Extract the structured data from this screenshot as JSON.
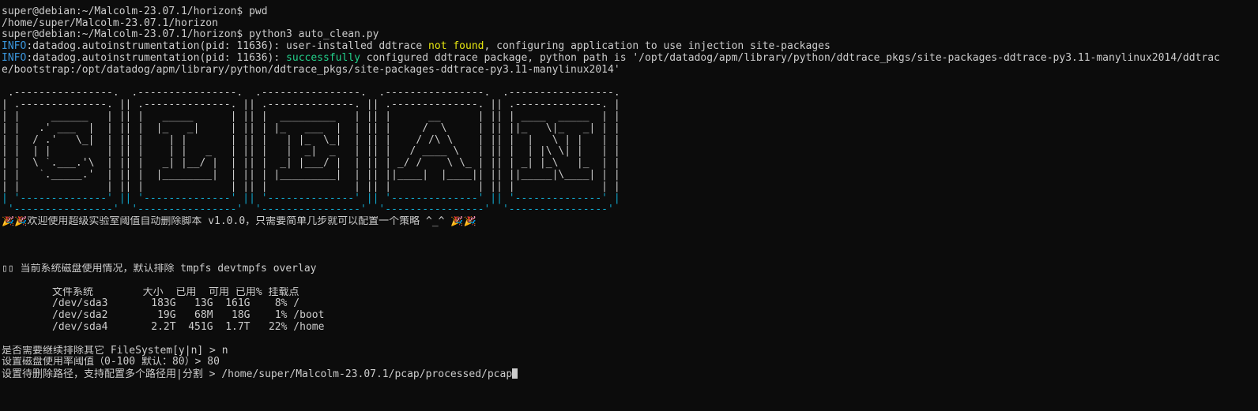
{
  "terminal": {
    "lines": [
      "super@debian:~/Malcolm-23.07.1/horizon$ pwd",
      "/home/super/Malcolm-23.07.1/horizon",
      "super@debian:~/Malcolm-23.07.1/horizon$ python3 auto_clean.py"
    ],
    "info1": {
      "prefix": "INFO",
      "text_a": ":datadog.autoinstrumentation(pid: 11636): user-installed ddtrace ",
      "highlight": "not found",
      "text_b": ", configuring application to use injection site-packages"
    },
    "info2": {
      "prefix": "INFO",
      "text_a": ":datadog.autoinstrumentation(pid: 11636): ",
      "highlight": "successfully",
      "text_b": " configured ddtrace package, python path is '/opt/datadog/apm/library/python/ddtrace_pkgs/site-packages-ddtrace-py3.11-manylinux2014/ddtrac",
      "text_c": "e/bootstrap:/opt/datadog/apm/library/python/ddtrace_pkgs/site-packages-ddtrace-py3.11-manylinux2014'"
    },
    "banner_art": [
      " .----------------.  .----------------.  .----------------.  .----------------.  .-----------------.",
      "| .--------------. || .--------------. || .--------------. || .--------------. || .--------------. |",
      "| |     ______   | || |   _____      | || |  _________   | || |      __      | || | ____  _____  | |",
      "| |   .' ___  |  | || |  |_   _|     | || | |_   ___  |  | || |     /  \\     | || ||_   \\|_   _| | |",
      "| |  / .'   \\_|  | || |    | |       | || |   | |_  \\_|  | || |    / /\\ \\    | || |  |   \\ | |   | |",
      "| |  | |         | || |    | |   _   | || |   |  _|  _   | || |   / ____ \\   | || |  | |\\ \\| |   | |",
      "| |  \\ `.___.'\\  | || |   _| |__/ |  | || |  _| |___/ |  | || | _/ /    \\ \\_ | || | _| |_\\   |_  | |",
      "| |   `._____.'  | || |  |________|  | || | |_________|  | || ||____|  |____|| || ||_____|\\____| | |",
      "| |              | || |              | || |              | || |              | || |              | |",
      "| '--------------' || '--------------' || '--------------' || '--------------' || '--------------' |",
      " '----------------'  '----------------'  '----------------'  '----------------'  '----------------'"
    ],
    "welcome": "🎉🎉欢迎使用超级实验室阈值自动删除脚本 v1.0.0，只需要简单几步就可以配置一个策略 ^_^ 🎉🎉",
    "disk_header": "▯▯ 当前系统磁盘使用情况，默认排除 tmpfs devtmpfs overlay",
    "disk_table": {
      "columns": [
        "文件系统",
        "大小",
        "已用",
        "可用",
        "已用%",
        "挂载点"
      ],
      "rows": [
        [
          "/dev/sda3",
          "183G",
          "13G",
          "161G",
          "8%",
          "/"
        ],
        [
          "/dev/sda2",
          "19G",
          "68M",
          "18G",
          "1%",
          "/boot"
        ],
        [
          "/dev/sda4",
          "2.2T",
          "451G",
          "1.7T",
          "22%",
          "/home"
        ]
      ]
    },
    "prompt1": "是否需要继续排除其它 FileSystem[y|n] > n",
    "prompt2": "设置磁盘使用率阈值（0-100 默认：80）> 80",
    "prompt3": "设置待删除路径，支持配置多个路径用|分割 > /home/super/Malcolm-23.07.1/pcap/processed/pcap"
  },
  "colors": {
    "background": "#0c0c0c",
    "foreground": "#cccccc",
    "info": "#3a96dd",
    "warning": "#e5e510",
    "success": "#23d18b",
    "art_accent": "#11a8cd"
  }
}
